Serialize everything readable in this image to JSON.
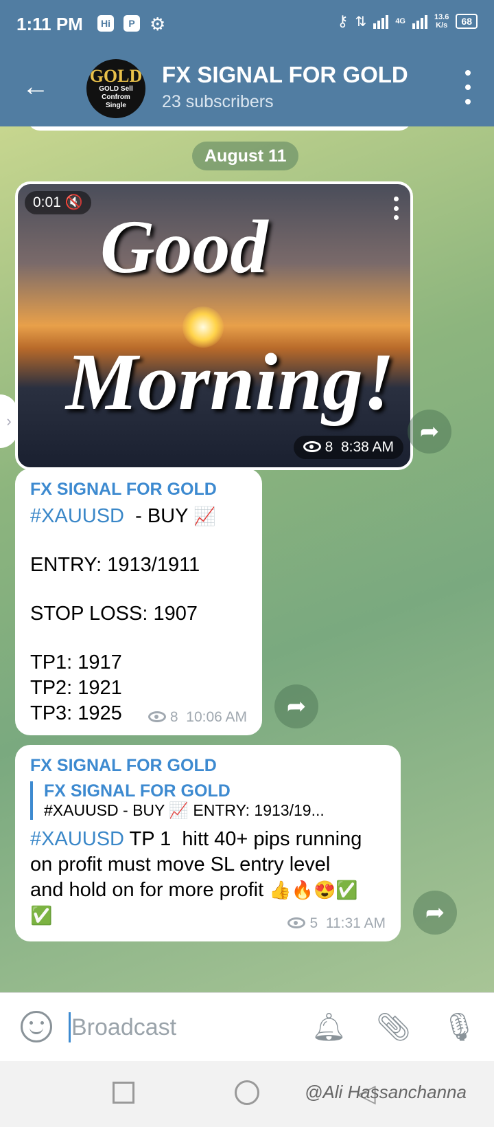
{
  "status_bar": {
    "time": "1:11 PM",
    "network": "4G",
    "speed_value": "13.6",
    "speed_unit": "K/s",
    "battery": "68"
  },
  "header": {
    "title": "FX SIGNAL FOR GOLD",
    "subtitle": "23 subscribers",
    "avatar_text": "GOLD",
    "avatar_sub": [
      "GOLD Sell",
      "Confrom",
      "Single"
    ]
  },
  "chat": {
    "date": "August 11",
    "media": {
      "duration": "0:01",
      "text_line1": "Good",
      "text_line2": "Morning!",
      "views": "8",
      "time": "8:38 AM"
    },
    "msg1": {
      "sender": "FX SIGNAL FOR GOLD",
      "hashtag": "#XAUUSD",
      "action": "  - BUY ",
      "entry": "ENTRY:  1913/1911",
      "stop_loss": "STOP LOSS: 1907",
      "tp1": "TP1:  1917",
      "tp2": "TP2:  1921",
      "tp3": "TP3:  1925",
      "views": "8",
      "time": "10:06 AM"
    },
    "msg2": {
      "sender": "FX SIGNAL FOR GOLD",
      "reply_title": "FX SIGNAL FOR GOLD",
      "reply_text": "#XAUUSD   - BUY 📈    ENTRY:  1913/19...",
      "hashtag": "#XAUUSD",
      "text1": " TP 1  hitt 40+ pips running",
      "text2": "on profit must move SL entry level",
      "text3": "and hold on for more profit ",
      "emojis": "👍🔥😍✅",
      "emoji2": "✅",
      "views": "5",
      "time": "11:31 AM"
    }
  },
  "input": {
    "placeholder": "Broadcast"
  },
  "watermark": "@Ali Hassanchanna"
}
